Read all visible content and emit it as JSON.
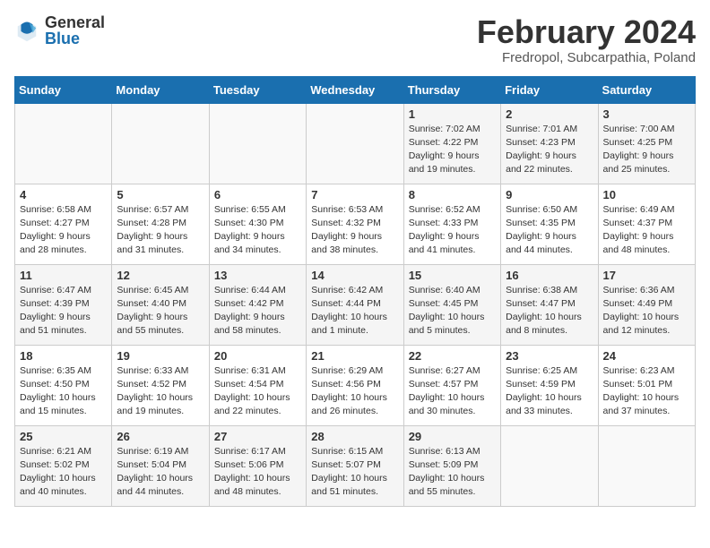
{
  "logo": {
    "general": "General",
    "blue": "Blue"
  },
  "title": "February 2024",
  "location": "Fredropol, Subcarpathia, Poland",
  "days_of_week": [
    "Sunday",
    "Monday",
    "Tuesday",
    "Wednesday",
    "Thursday",
    "Friday",
    "Saturday"
  ],
  "weeks": [
    [
      {
        "day": "",
        "detail": ""
      },
      {
        "day": "",
        "detail": ""
      },
      {
        "day": "",
        "detail": ""
      },
      {
        "day": "",
        "detail": ""
      },
      {
        "day": "1",
        "detail": "Sunrise: 7:02 AM\nSunset: 4:22 PM\nDaylight: 9 hours\nand 19 minutes."
      },
      {
        "day": "2",
        "detail": "Sunrise: 7:01 AM\nSunset: 4:23 PM\nDaylight: 9 hours\nand 22 minutes."
      },
      {
        "day": "3",
        "detail": "Sunrise: 7:00 AM\nSunset: 4:25 PM\nDaylight: 9 hours\nand 25 minutes."
      }
    ],
    [
      {
        "day": "4",
        "detail": "Sunrise: 6:58 AM\nSunset: 4:27 PM\nDaylight: 9 hours\nand 28 minutes."
      },
      {
        "day": "5",
        "detail": "Sunrise: 6:57 AM\nSunset: 4:28 PM\nDaylight: 9 hours\nand 31 minutes."
      },
      {
        "day": "6",
        "detail": "Sunrise: 6:55 AM\nSunset: 4:30 PM\nDaylight: 9 hours\nand 34 minutes."
      },
      {
        "day": "7",
        "detail": "Sunrise: 6:53 AM\nSunset: 4:32 PM\nDaylight: 9 hours\nand 38 minutes."
      },
      {
        "day": "8",
        "detail": "Sunrise: 6:52 AM\nSunset: 4:33 PM\nDaylight: 9 hours\nand 41 minutes."
      },
      {
        "day": "9",
        "detail": "Sunrise: 6:50 AM\nSunset: 4:35 PM\nDaylight: 9 hours\nand 44 minutes."
      },
      {
        "day": "10",
        "detail": "Sunrise: 6:49 AM\nSunset: 4:37 PM\nDaylight: 9 hours\nand 48 minutes."
      }
    ],
    [
      {
        "day": "11",
        "detail": "Sunrise: 6:47 AM\nSunset: 4:39 PM\nDaylight: 9 hours\nand 51 minutes."
      },
      {
        "day": "12",
        "detail": "Sunrise: 6:45 AM\nSunset: 4:40 PM\nDaylight: 9 hours\nand 55 minutes."
      },
      {
        "day": "13",
        "detail": "Sunrise: 6:44 AM\nSunset: 4:42 PM\nDaylight: 9 hours\nand 58 minutes."
      },
      {
        "day": "14",
        "detail": "Sunrise: 6:42 AM\nSunset: 4:44 PM\nDaylight: 10 hours\nand 1 minute."
      },
      {
        "day": "15",
        "detail": "Sunrise: 6:40 AM\nSunset: 4:45 PM\nDaylight: 10 hours\nand 5 minutes."
      },
      {
        "day": "16",
        "detail": "Sunrise: 6:38 AM\nSunset: 4:47 PM\nDaylight: 10 hours\nand 8 minutes."
      },
      {
        "day": "17",
        "detail": "Sunrise: 6:36 AM\nSunset: 4:49 PM\nDaylight: 10 hours\nand 12 minutes."
      }
    ],
    [
      {
        "day": "18",
        "detail": "Sunrise: 6:35 AM\nSunset: 4:50 PM\nDaylight: 10 hours\nand 15 minutes."
      },
      {
        "day": "19",
        "detail": "Sunrise: 6:33 AM\nSunset: 4:52 PM\nDaylight: 10 hours\nand 19 minutes."
      },
      {
        "day": "20",
        "detail": "Sunrise: 6:31 AM\nSunset: 4:54 PM\nDaylight: 10 hours\nand 22 minutes."
      },
      {
        "day": "21",
        "detail": "Sunrise: 6:29 AM\nSunset: 4:56 PM\nDaylight: 10 hours\nand 26 minutes."
      },
      {
        "day": "22",
        "detail": "Sunrise: 6:27 AM\nSunset: 4:57 PM\nDaylight: 10 hours\nand 30 minutes."
      },
      {
        "day": "23",
        "detail": "Sunrise: 6:25 AM\nSunset: 4:59 PM\nDaylight: 10 hours\nand 33 minutes."
      },
      {
        "day": "24",
        "detail": "Sunrise: 6:23 AM\nSunset: 5:01 PM\nDaylight: 10 hours\nand 37 minutes."
      }
    ],
    [
      {
        "day": "25",
        "detail": "Sunrise: 6:21 AM\nSunset: 5:02 PM\nDaylight: 10 hours\nand 40 minutes."
      },
      {
        "day": "26",
        "detail": "Sunrise: 6:19 AM\nSunset: 5:04 PM\nDaylight: 10 hours\nand 44 minutes."
      },
      {
        "day": "27",
        "detail": "Sunrise: 6:17 AM\nSunset: 5:06 PM\nDaylight: 10 hours\nand 48 minutes."
      },
      {
        "day": "28",
        "detail": "Sunrise: 6:15 AM\nSunset: 5:07 PM\nDaylight: 10 hours\nand 51 minutes."
      },
      {
        "day": "29",
        "detail": "Sunrise: 6:13 AM\nSunset: 5:09 PM\nDaylight: 10 hours\nand 55 minutes."
      },
      {
        "day": "",
        "detail": ""
      },
      {
        "day": "",
        "detail": ""
      }
    ]
  ]
}
